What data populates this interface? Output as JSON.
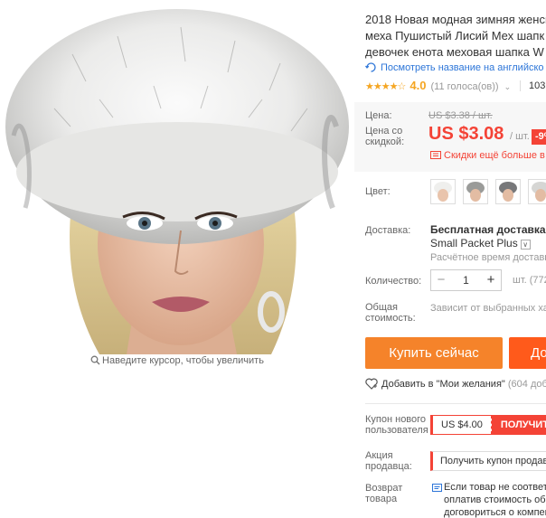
{
  "product_image": {
    "zoom_hint": "Наведите курсор, чтобы увеличить"
  },
  "product": {
    "title_lines": [
      "2018 Новая модная зимняя женск",
      "меха Пушистый Лисий Мех шапк",
      "девочек енота меховая шапка W"
    ],
    "translate_link": "Посмотреть название на английско",
    "rating_stars": "★★★★☆",
    "rating_value": "4.0",
    "votes": "(11 голоса(ов))",
    "orders": "103"
  },
  "price": {
    "label": "Цена:",
    "old": "US $3.38 / шт.",
    "discount_label": "Цена со скидкой:",
    "new": "US $3.08",
    "unit": "/ шт.",
    "discount_badge": "-9%",
    "discounts_link": "Скидки ещё больше в п"
  },
  "color": {
    "label": "Цвет:",
    "options": [
      "white-fur",
      "grey-fur",
      "silver-fox-fur",
      "white-fox-fur"
    ]
  },
  "shipping": {
    "label": "Доставка:",
    "main": "Бесплатная доставка в Ru",
    "method": "Small Packet Plus",
    "time": "Расчётное время доставки"
  },
  "quantity": {
    "label": "Количество:",
    "value": "1",
    "minus": "−",
    "plus": "+",
    "unit": "шт. (772"
  },
  "total": {
    "label": "Общая стоимость:",
    "value": "Зависит от выбранных хар"
  },
  "actions": {
    "buy_now": "Купить сейчас",
    "add_to_cart": "До",
    "wishlist": "Добавить в \"Мои желания\"",
    "wishlist_count": "(604 доба"
  },
  "coupons": {
    "new_user_label": "Купон нового пользователя",
    "new_user_value": "US $4.00",
    "new_user_get": "ПОЛУЧИТЬ",
    "seller_label": "Акция продавца:",
    "seller_value": "Получить купон продавц"
  },
  "refund": {
    "label": "Возврат товара",
    "lines": [
      "Если товар не соответс",
      "оплатив стоимость обр",
      "договориться о компен"
    ]
  },
  "colors": {
    "accent": "#f44336",
    "buy": "#f5832a",
    "link": "#2c75d8",
    "star": "#f5a623"
  }
}
